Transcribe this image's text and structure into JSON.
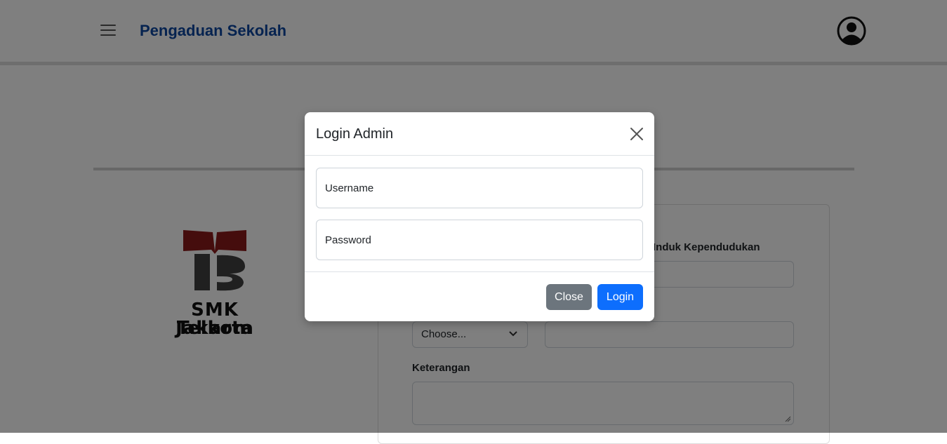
{
  "navbar": {
    "menu_icon": "hamburger-menu-icon",
    "brand": "Pengaduan Sekolah",
    "profile_icon": "user-circle-icon",
    "brand_color": "#0d47a1"
  },
  "logo": {
    "line1": "SMK Telkom",
    "line2": "Jakarta",
    "colors": {
      "book": "#8b1a1a",
      "mark": "#404040"
    }
  },
  "form": {
    "nik_label": "Induk Kependudukan",
    "select_value": "Choose...",
    "keterangan_label": "Keterangan"
  },
  "modal": {
    "title": "Login Admin",
    "username_placeholder": "Username",
    "password_placeholder": "Password",
    "close_label": "Close",
    "login_label": "Login",
    "colors": {
      "close_btn": "#6c757d",
      "login_btn": "#0d6efd"
    }
  }
}
